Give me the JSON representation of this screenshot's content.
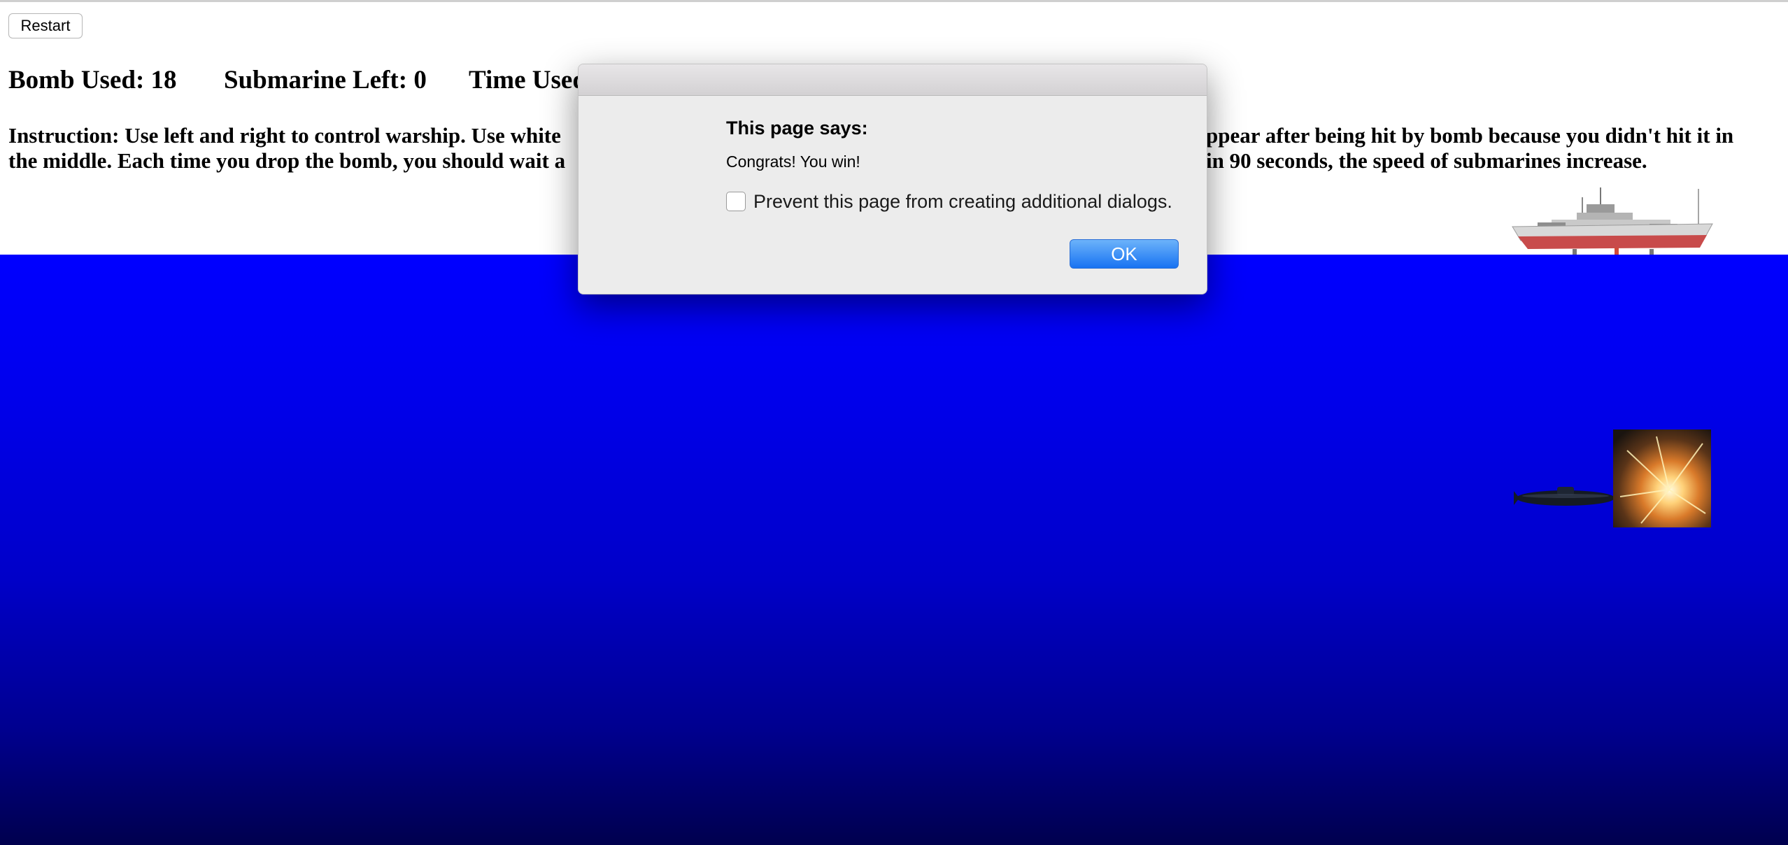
{
  "toolbar": {
    "restart_label": "Restart"
  },
  "stats": {
    "bombs_used": "Bomb Used: 18",
    "submarines_left": "Submarine Left: 0",
    "time_used": "Time Used"
  },
  "instruction": {
    "line1_left": "Instruction: Use left and right to control warship. Use white",
    "line1_right": "ppear after being hit by bomb because you didn't hit it in",
    "line2_left": "the middle. Each time you drop the bomb, you should wait a",
    "line2_right": "in 90 seconds, the speed of submarines increase."
  },
  "scene": {
    "sea_color_top": "#0000ff",
    "sea_color_bottom": "#00004e",
    "warship_icon": "warship-icon",
    "submarine_icon": "submarine-icon",
    "explosion_icon": "explosion-icon"
  },
  "dialog": {
    "heading": "This page says:",
    "message": "Congrats! You win!",
    "checkbox_label": "Prevent this page from creating additional dialogs.",
    "checkbox_checked": false,
    "ok_label": "OK",
    "accent_color": "#1a7bf5"
  }
}
